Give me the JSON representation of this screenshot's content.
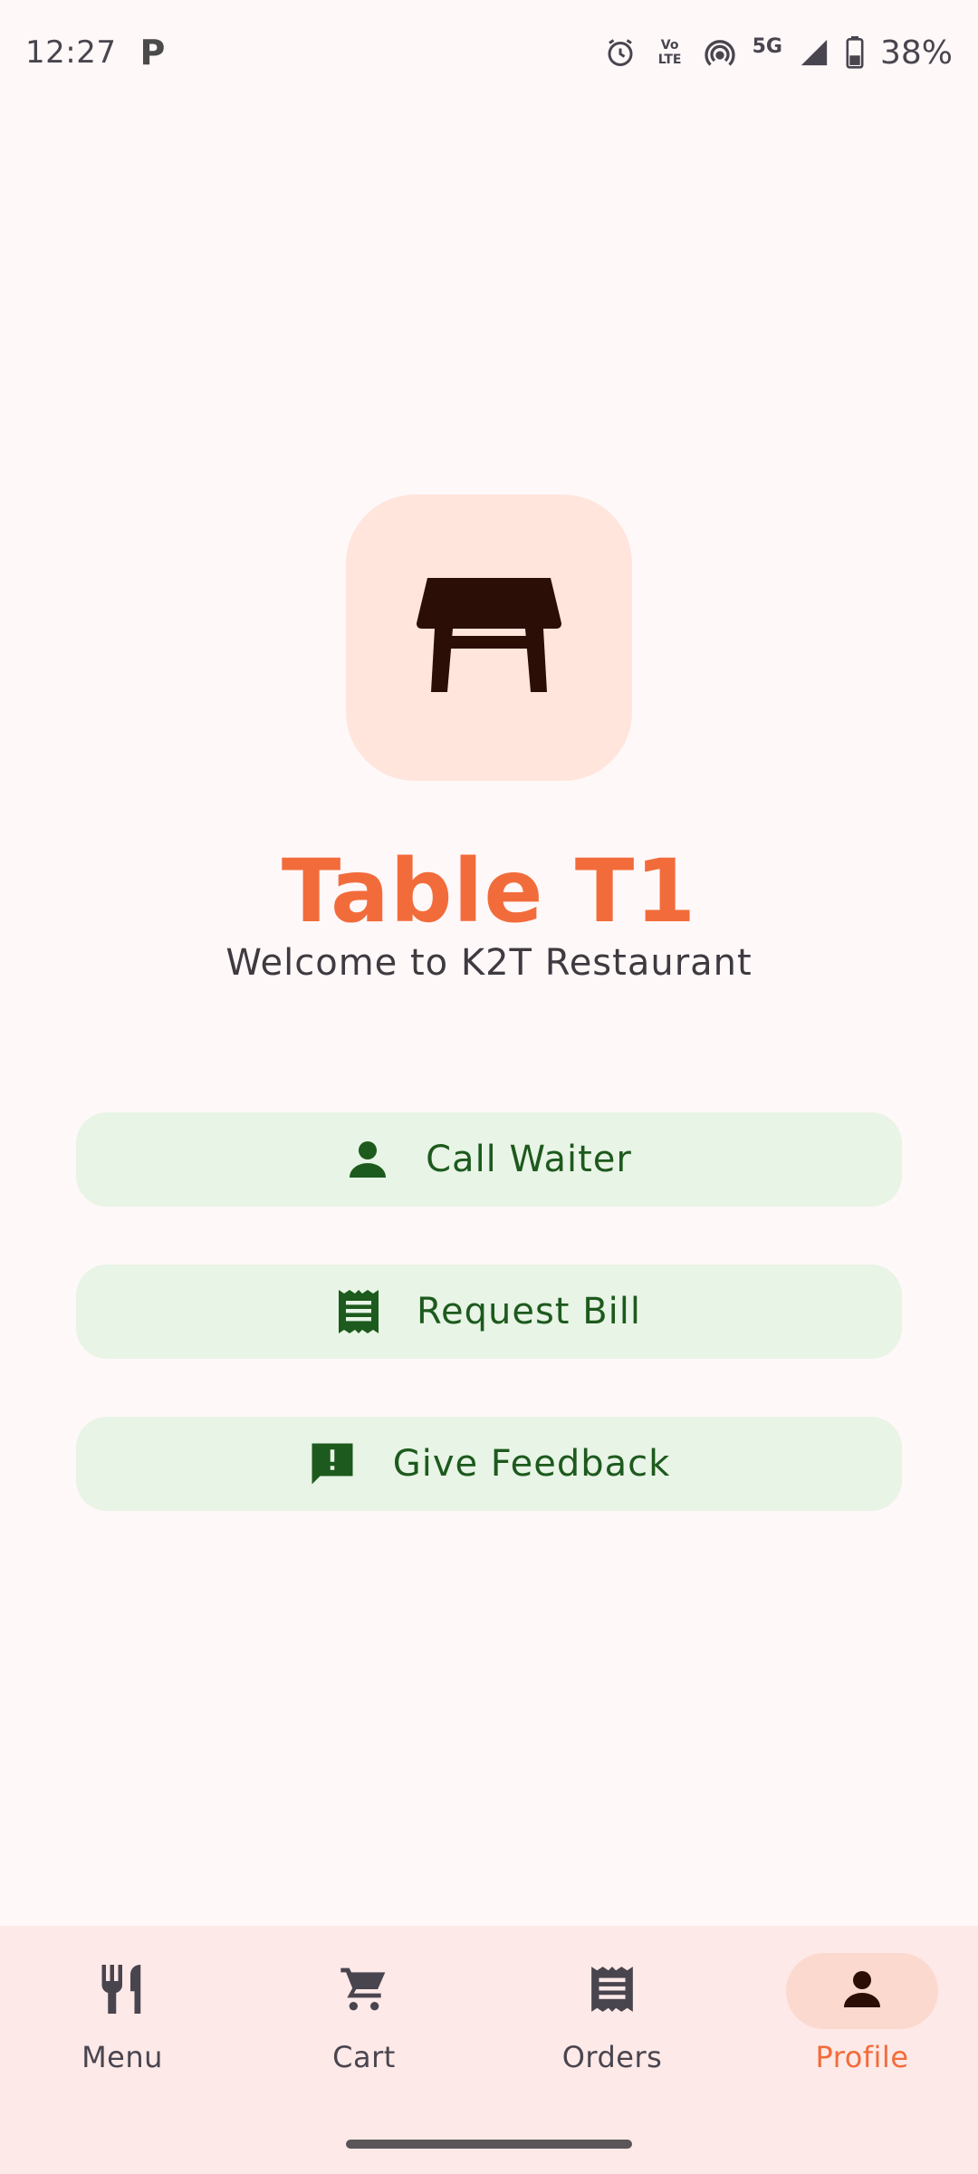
{
  "status_bar": {
    "time": "12:27",
    "parking_glyph": "P",
    "battery_percent": "38%",
    "network_label": "5G",
    "volte_label": "Vo LTE",
    "icons": [
      "parking-icon",
      "alarm-icon",
      "volte-icon",
      "hotspot-icon",
      "signal-icon",
      "battery-icon"
    ]
  },
  "header": {
    "table_icon": "table-icon",
    "title": "Table T1",
    "subtitle": "Welcome to K2T Restaurant"
  },
  "actions": [
    {
      "label": "Call Waiter",
      "icon": "person-icon"
    },
    {
      "label": "Request Bill",
      "icon": "receipt-icon"
    },
    {
      "label": "Give Feedback",
      "icon": "feedback-icon"
    }
  ],
  "bottom_nav": {
    "items": [
      {
        "label": "Menu",
        "icon": "restaurant-icon",
        "active": false
      },
      {
        "label": "Cart",
        "icon": "cart-icon",
        "active": false
      },
      {
        "label": "Orders",
        "icon": "orders-icon",
        "active": false
      },
      {
        "label": "Profile",
        "icon": "profile-icon",
        "active": true
      }
    ]
  },
  "colors": {
    "accent": "#F26C3B",
    "tile_bg": "#FFE5DC",
    "button_bg": "#E8F4E6",
    "button_fg": "#1D5A1D",
    "nav_bg": "#FDE9E7",
    "page_bg": "#FFF8F9"
  }
}
